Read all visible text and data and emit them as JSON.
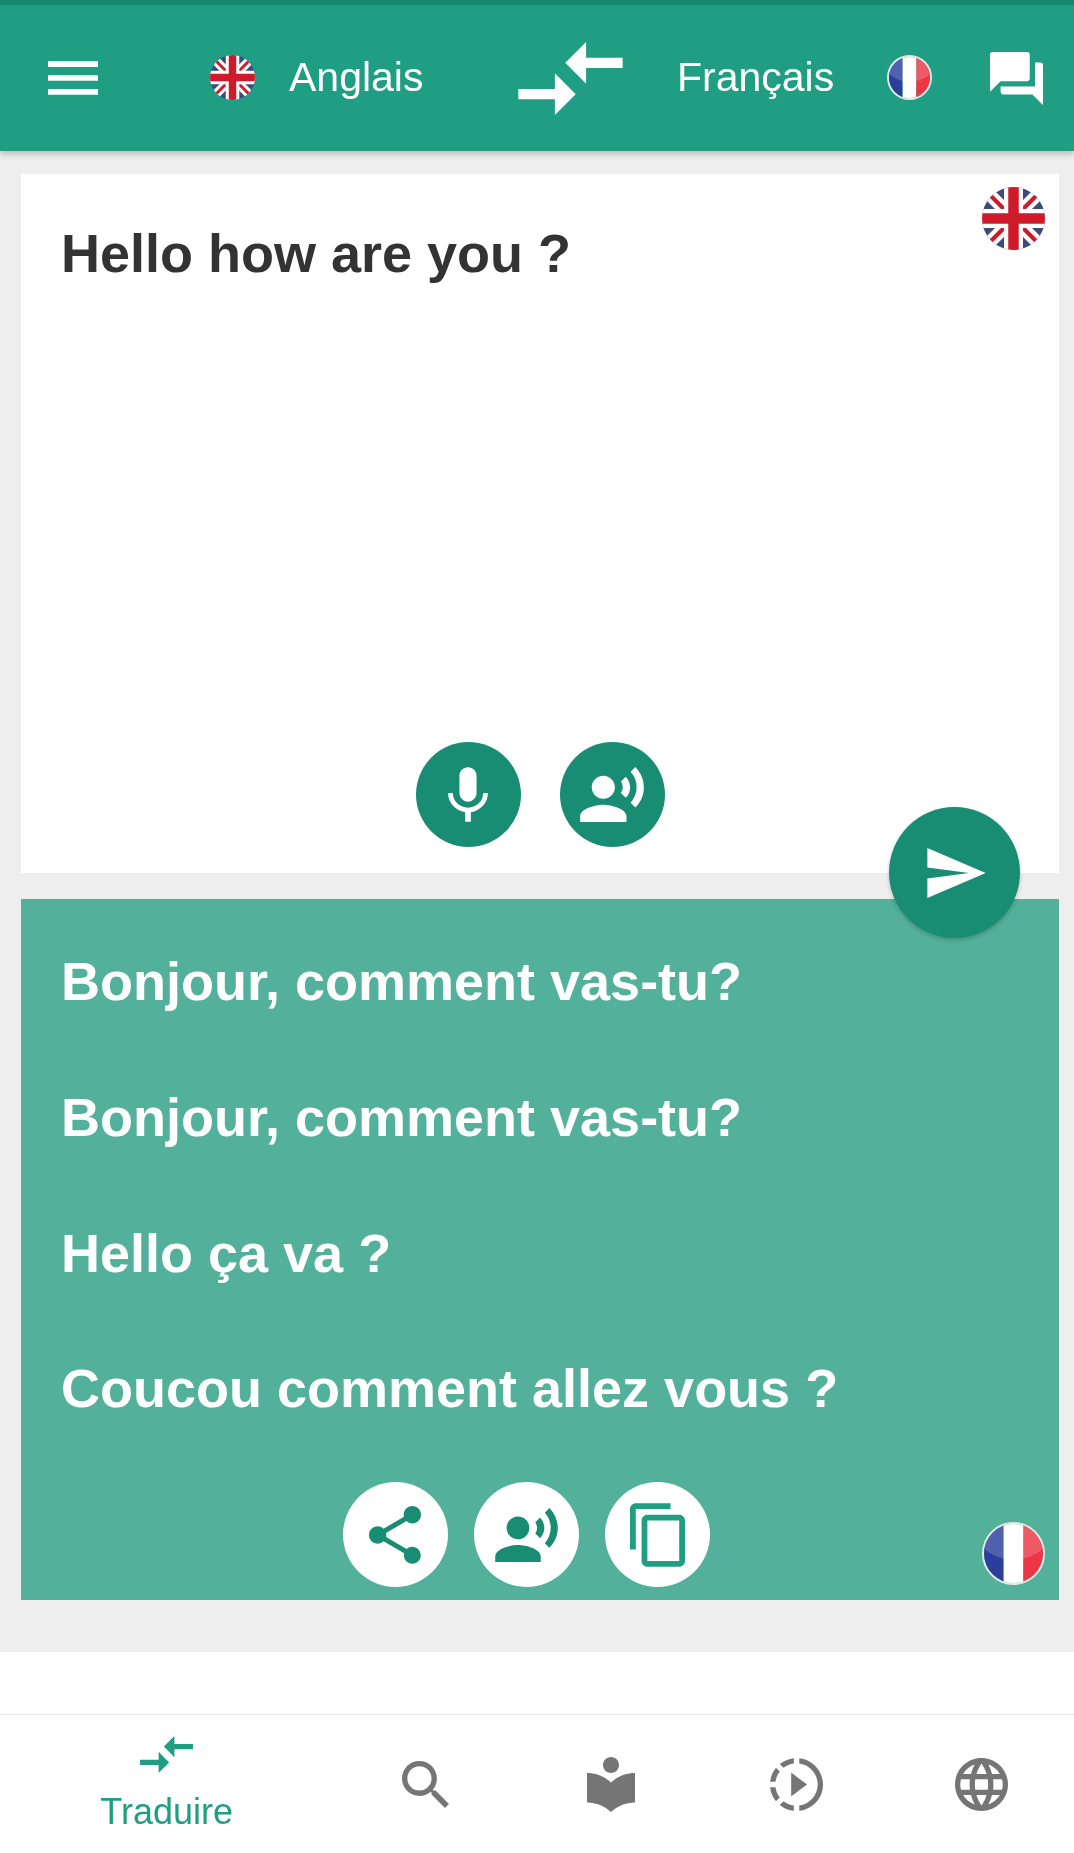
{
  "top_bar": {
    "source_language": {
      "name": "Anglais"
    },
    "target_language": {
      "name": "Français"
    }
  },
  "source_panel": {
    "value": "Hello how are you ?"
  },
  "translation_panel": {
    "results": [
      "Bonjour, comment vas-tu?",
      "Bonjour, comment vas-tu?",
      "Hello ça va ?",
      "Coucou comment allez vous ?"
    ]
  },
  "bottom_nav": {
    "items": [
      {
        "label": "Traduire",
        "selected": true
      },
      {
        "selected": false
      },
      {
        "selected": false
      },
      {
        "selected": false
      },
      {
        "selected": false
      }
    ]
  }
}
